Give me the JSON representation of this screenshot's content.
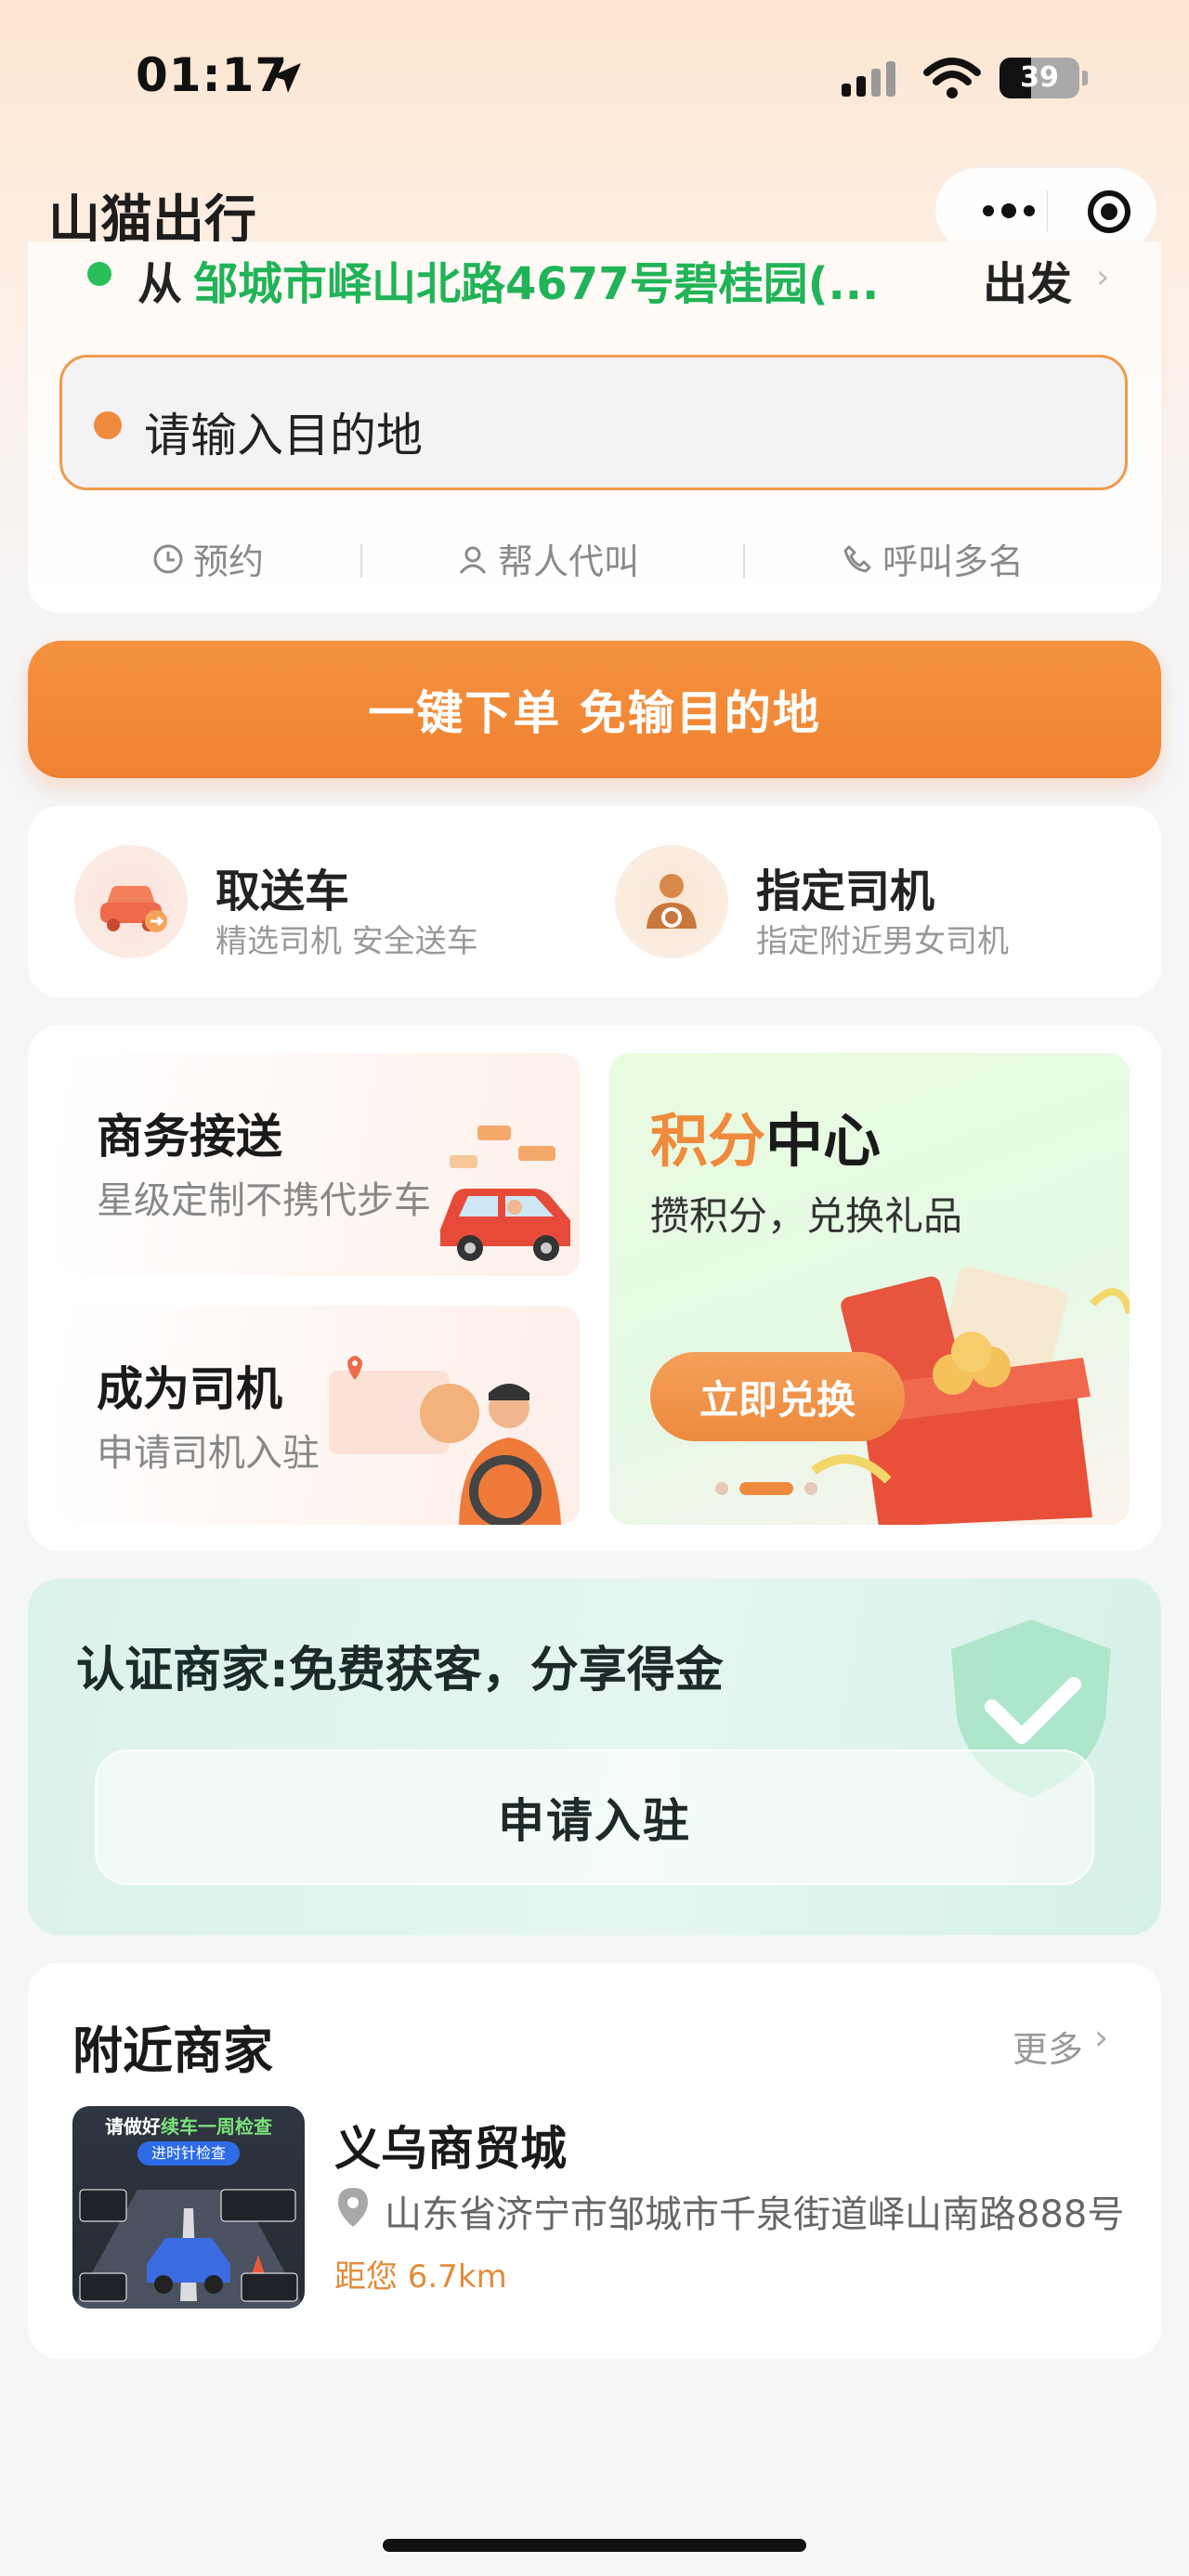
{
  "status_bar": {
    "time": "01:17",
    "battery": "39"
  },
  "header": {
    "title": "山猫出行"
  },
  "location": {
    "from_prefix": "从",
    "from_address": "邹城市峄山北路4677号碧桂园(...",
    "from_suffix": "出发",
    "destination_placeholder": "请输入目的地",
    "quick_actions": [
      "预约",
      "帮人代叫",
      "呼叫多名"
    ]
  },
  "order_button": "一键下单 免输目的地",
  "services": [
    {
      "title": "取送车",
      "subtitle": "精选司机 安全送车"
    },
    {
      "title": "指定司机",
      "subtitle": "指定附近男女司机"
    }
  ],
  "promos": {
    "business": {
      "title": "商务接送",
      "subtitle": "星级定制不携代步车"
    },
    "driver": {
      "title": "成为司机",
      "subtitle": "申请司机入驻"
    },
    "points": {
      "title_a": "积分",
      "title_b": "中心",
      "subtitle": "攒积分，兑换礼品",
      "button": "立即兑换"
    }
  },
  "merchant": {
    "title": "认证商家:免费获客，分享得金",
    "button": "申请入驻"
  },
  "nearby": {
    "title": "附近商家",
    "more": "更多",
    "item": {
      "name": "义乌商贸城",
      "address": "山东省济宁市邹城市千泉街道峄山南路888号",
      "distance": "距您 6.7km",
      "image_caption_1": "请做好",
      "image_caption_2": "续车一周检查",
      "image_caption_3": "进时针检查"
    }
  },
  "colors": {
    "accent": "#ef8231",
    "green": "#21b357"
  }
}
